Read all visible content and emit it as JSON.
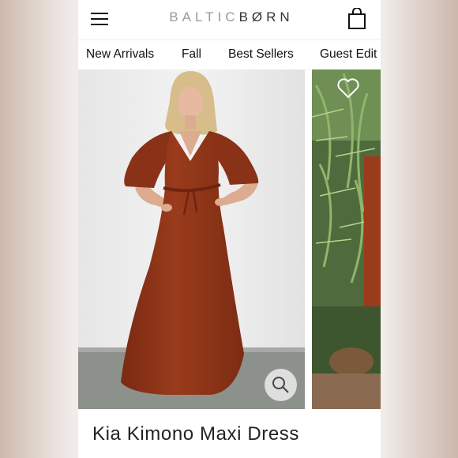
{
  "header": {
    "brand_left": "BALTIC",
    "brand_right": "BØRN",
    "icons": {
      "menu": "hamburger-menu-icon",
      "bag": "shopping-bag-icon"
    }
  },
  "nav": {
    "items": [
      "New Arrivals",
      "Fall",
      "Best Sellers",
      "Guest Edit"
    ]
  },
  "gallery": {
    "icons": {
      "zoom": "magnifier-icon",
      "favorite": "heart-icon"
    }
  },
  "product": {
    "title": "Kia Kimono Maxi Dress",
    "dress_color": "#8d3418"
  }
}
